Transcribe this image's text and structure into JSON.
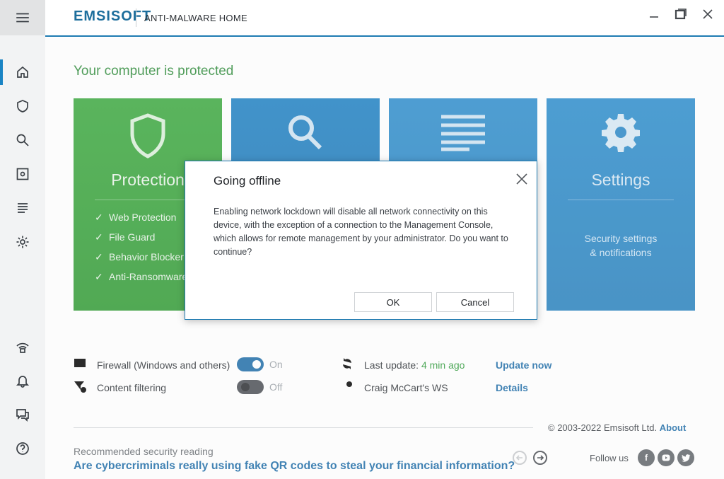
{
  "titlebar": {
    "brand": "EMSISOFT",
    "product": "ANTI-MALWARE HOME"
  },
  "main": {
    "headline": "Your computer is protected",
    "tiles": [
      {
        "title": "Protection",
        "items": [
          "Web Protection",
          "File Guard",
          "Behavior Blocker",
          "Anti-Ransomware"
        ]
      },
      {
        "title": ""
      },
      {
        "title": ""
      },
      {
        "title": "Settings",
        "sub1": "Security settings",
        "sub2": "& notifications"
      }
    ]
  },
  "status": {
    "firewall_label": "Firewall (Windows and others)",
    "firewall_state": "On",
    "content_label": "Content filtering",
    "content_state": "Off",
    "last_update_label": "Last update:",
    "last_update_value": "4 min ago",
    "update_now": "Update now",
    "ws_name": "Craig McCart's WS",
    "details": "Details"
  },
  "footer": {
    "copyright": "© 2003-2022 Emsisoft Ltd.",
    "about": "About",
    "rec_label": "Recommended security reading",
    "rec_title": "Are cybercriminals really using fake QR codes to steal your financial information?",
    "follow_us": "Follow us"
  },
  "modal": {
    "title": "Going offline",
    "body": "Enabling network lockdown will disable all network connectivity on this device, with the exception of a connection to the Management Console, which allows for remote management by your administrator. Do you want to continue?",
    "ok": "OK",
    "cancel": "Cancel"
  },
  "colors": {
    "accent_blue": "#1e7bb2",
    "protected_green": "#2e8b3a",
    "tile_green": "#3aa83d"
  }
}
